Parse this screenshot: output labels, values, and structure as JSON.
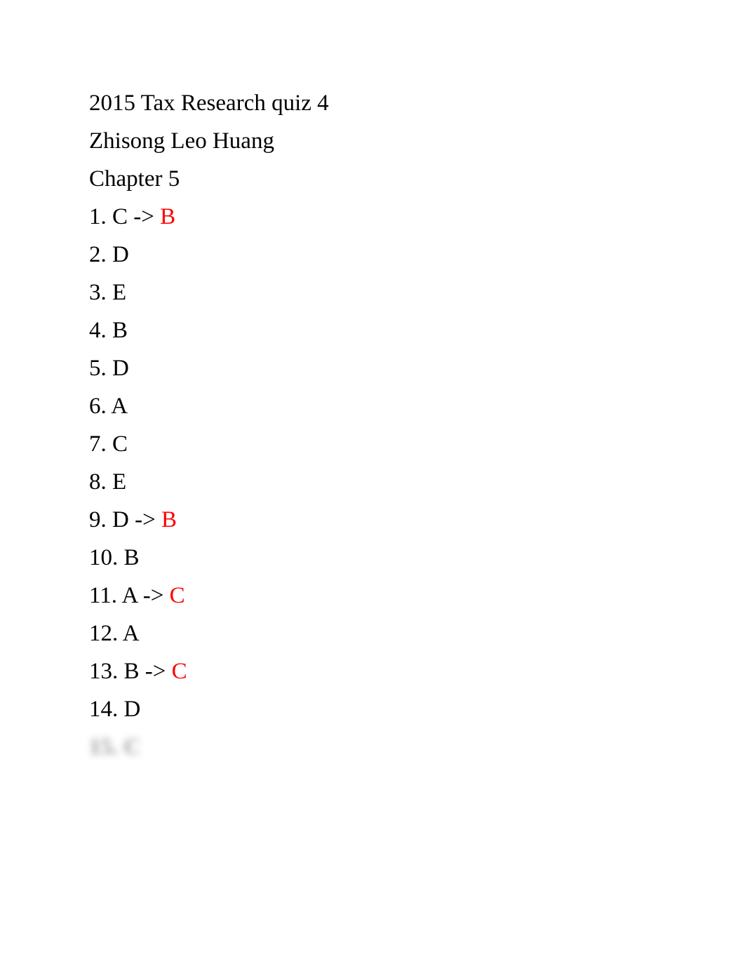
{
  "document": {
    "title": "2015 Tax Research quiz 4",
    "author": "Zhisong Leo Huang",
    "chapter": "Chapter 5",
    "correction_color": "#ff0000",
    "answers": [
      {
        "num": "1.",
        "answer": "C",
        "arrow": "->",
        "correction": "B"
      },
      {
        "num": "2.",
        "answer": "D"
      },
      {
        "num": "3.",
        "answer": "E"
      },
      {
        "num": "4.",
        "answer": "B"
      },
      {
        "num": "5.",
        "answer": "D"
      },
      {
        "num": "6.",
        "answer": "A"
      },
      {
        "num": "7.",
        "answer": "C"
      },
      {
        "num": "8.",
        "answer": "E"
      },
      {
        "num": "9.",
        "answer": "D",
        "arrow": "->",
        "correction": "B"
      },
      {
        "num": "10.",
        "answer": "B"
      },
      {
        "num": "11.",
        "answer": "A",
        "arrow": "->",
        "correction": "C"
      },
      {
        "num": "12.",
        "answer": "A"
      },
      {
        "num": "13.",
        "answer": "B",
        "arrow": "->",
        "correction": "C"
      },
      {
        "num": "14.",
        "answer": "D"
      }
    ],
    "blurred_line": "15. C"
  }
}
